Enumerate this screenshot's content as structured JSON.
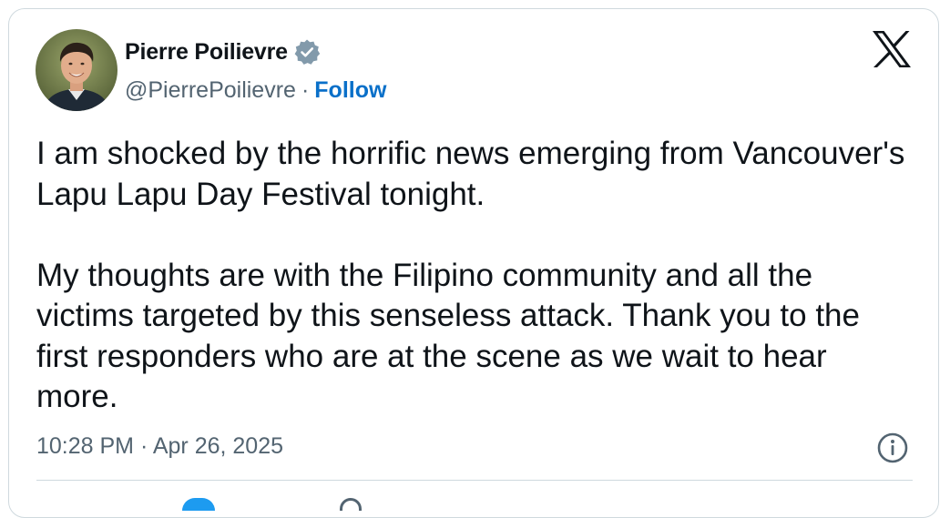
{
  "author": {
    "display_name": "Pierre Poilievre",
    "handle": "@PierrePoilievre",
    "separator": "·",
    "follow_label": "Follow",
    "verified": true
  },
  "tweet": {
    "paragraphs": [
      "I am shocked by the horrific news emerging from Vancouver's Lapu Lapu Day Festival tonight.",
      "My thoughts are with the Filipino community and all the victims targeted by this senseless attack. Thank you to the first responders who are at the scene as we wait to hear more."
    ],
    "timestamp": "10:28 PM · Apr 26, 2025"
  },
  "icons": {
    "brand": "x-logo-icon",
    "verified": "verified-badge-icon",
    "info": "info-icon"
  },
  "colors": {
    "text": "#0f1419",
    "secondary": "#536471",
    "link": "#0a70c9",
    "border": "#cfd9de",
    "accent": "#1d9bf0"
  }
}
